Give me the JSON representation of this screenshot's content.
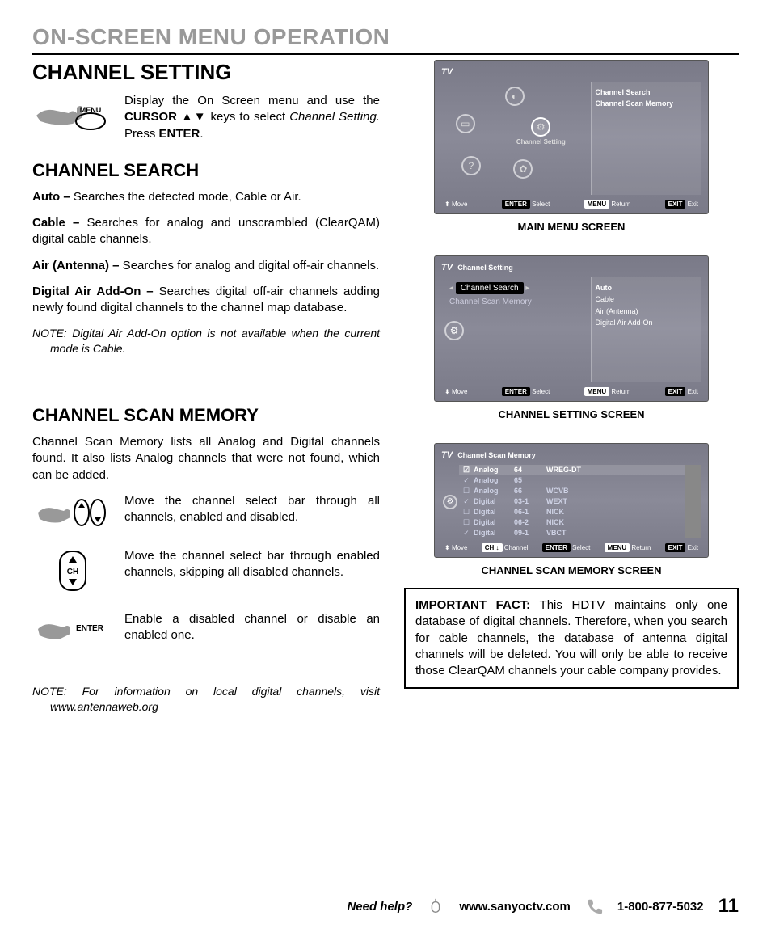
{
  "header": "ON-SCREEN MENU OPERATION",
  "section_title": "CHANNEL SETTING",
  "intro": {
    "text_prefix": "Display the On Screen menu and use the ",
    "cursor": "CURSOR ▲▼",
    "text_mid": " keys to select ",
    "target": "Channel Setting.",
    "text_suffix": " Press ",
    "enter": "ENTER",
    "period": "."
  },
  "search": {
    "title": "CHANNEL SEARCH",
    "items": [
      {
        "label": "Auto –",
        "desc": " Searches the detected mode, Cable or Air."
      },
      {
        "label": "Cable –",
        "desc": " Searches for analog and unscrambled (ClearQAM) digital cable channels."
      },
      {
        "label": "Air (Antenna) –",
        "desc": " Searches for analog and digital off-air channels."
      },
      {
        "label": "Digital Air Add-On –",
        "desc": " Searches digital off-air channels adding newly found digital channels to the channel map database."
      }
    ],
    "note_label": "NOTE:",
    "note_text": " Digital Air Add-On option is not available when the current mode is Cable."
  },
  "memory": {
    "title": "CHANNEL SCAN MEMORY",
    "intro": "Channel Scan Memory lists all Analog and Digital channels found. It also lists Analog channels that were not found, which can be added.",
    "rows": [
      "Move the channel select bar through all channels, enabled and disabled.",
      "Move the channel select bar through enabled channels, skipping all disabled channels.",
      "Enable a disabled channel or disable an enabled one."
    ],
    "note_label": "NOTE:",
    "note_text": " For information on local digital channels, visit www.antennaweb.org"
  },
  "screens": {
    "main": {
      "title": "TV",
      "label": "Channel Setting",
      "right_items": [
        "Channel Search",
        "Channel Scan Memory"
      ],
      "hints": {
        "move": "Move",
        "select": "Select",
        "return": "Return",
        "exit": "Exit"
      },
      "btns": {
        "enter": "ENTER",
        "menu": "MENU",
        "exit": "EXIT"
      },
      "caption": "MAIN MENU SCREEN"
    },
    "setting": {
      "title": "TV",
      "breadcrumb": "Channel Setting",
      "left_items": [
        "Channel Search",
        "Channel Scan Memory"
      ],
      "right_items": [
        "Auto",
        "Cable",
        "Air (Antenna)",
        "Digital Air Add-On"
      ],
      "caption": "CHANNEL SETTING SCREEN"
    },
    "mem": {
      "title": "TV",
      "breadcrumb": "Channel Scan Memory",
      "rows": [
        {
          "on": true,
          "type": "Analog",
          "num": "64",
          "name": "WREG-DT",
          "sel": true
        },
        {
          "on": true,
          "type": "Analog",
          "num": "65",
          "name": "",
          "check": "✓"
        },
        {
          "on": false,
          "type": "Analog",
          "num": "66",
          "name": "WCVB"
        },
        {
          "on": true,
          "type": "Digital",
          "num": "03-1",
          "name": "WEXT",
          "check": "✓"
        },
        {
          "on": false,
          "type": "Digital",
          "num": "06-1",
          "name": "NICK"
        },
        {
          "on": false,
          "type": "Digital",
          "num": "06-2",
          "name": "NICK"
        },
        {
          "on": true,
          "type": "Digital",
          "num": "09-1",
          "name": "VBCT",
          "check": "✓"
        }
      ],
      "hints": {
        "move": "Move",
        "channel": "Channel",
        "select": "Select",
        "return": "Return",
        "exit": "Exit"
      },
      "btns": {
        "ch": "CH ↕",
        "enter": "ENTER",
        "menu": "MENU",
        "exit": "EXIT"
      },
      "caption": "CHANNEL SCAN MEMORY SCREEN"
    }
  },
  "important": {
    "label": "IMPORTANT FACT:",
    "text": " This HDTV maintains only one database of digital channels. Therefore, when you search for cable channels, the database of antenna digital channels will be deleted. You will only be able to receive those ClearQAM channels your cable company provides."
  },
  "footer": {
    "help": "Need help?",
    "url": "www.sanyoctv.com",
    "phone": "1-800-877-5032",
    "page": "11"
  },
  "icon_labels": {
    "menu": "MENU",
    "enter": "ENTER",
    "ch": "CH"
  }
}
